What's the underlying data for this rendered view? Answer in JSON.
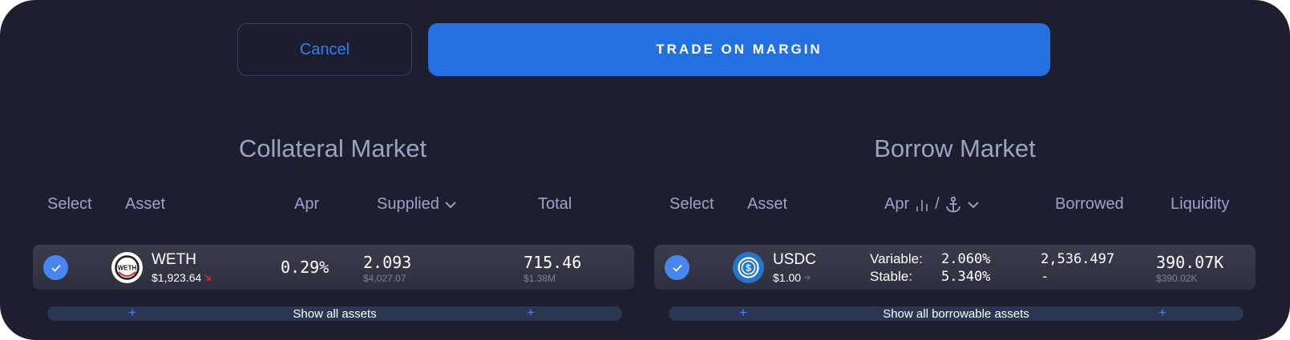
{
  "actions": {
    "cancel_label": "Cancel",
    "trade_label": "TRADE ON MARGIN"
  },
  "collateral": {
    "title": "Collateral Market",
    "headers": {
      "select": "Select",
      "asset": "Asset",
      "apr": "Apr",
      "supplied": "Supplied",
      "total": "Total"
    },
    "row": {
      "selected": true,
      "symbol": "WETH",
      "price": "$1,923.64",
      "price_trend": "down",
      "icon_text": "WETH",
      "apr": "0.29%",
      "supplied": "2.093",
      "supplied_usd": "$4,027.07",
      "total": "715.46",
      "total_usd": "$1.38M"
    },
    "show_all_label": "Show all assets"
  },
  "borrow": {
    "title": "Borrow Market",
    "headers": {
      "select": "Select",
      "asset": "Asset",
      "apr": "Apr",
      "apr_sep": "/",
      "borrowed": "Borrowed",
      "liquidity": "Liquidity"
    },
    "row": {
      "selected": true,
      "symbol": "USDC",
      "price": "$1.00",
      "price_trend": "flat",
      "variable_label": "Variable:",
      "variable_rate": "2.060%",
      "stable_label": "Stable:",
      "stable_rate": "5.340%",
      "borrowed": "2,536.497",
      "borrowed_secondary": "-",
      "liquidity": "390.07K",
      "liquidity_usd": "$390.02K"
    },
    "show_all_label": "Show all borrowable assets"
  },
  "colors": {
    "background": "#1e1e31",
    "primary": "#2370e0",
    "accent": "#4a86f0",
    "muted_text": "#9aa4c4",
    "down": "#e0242c"
  }
}
